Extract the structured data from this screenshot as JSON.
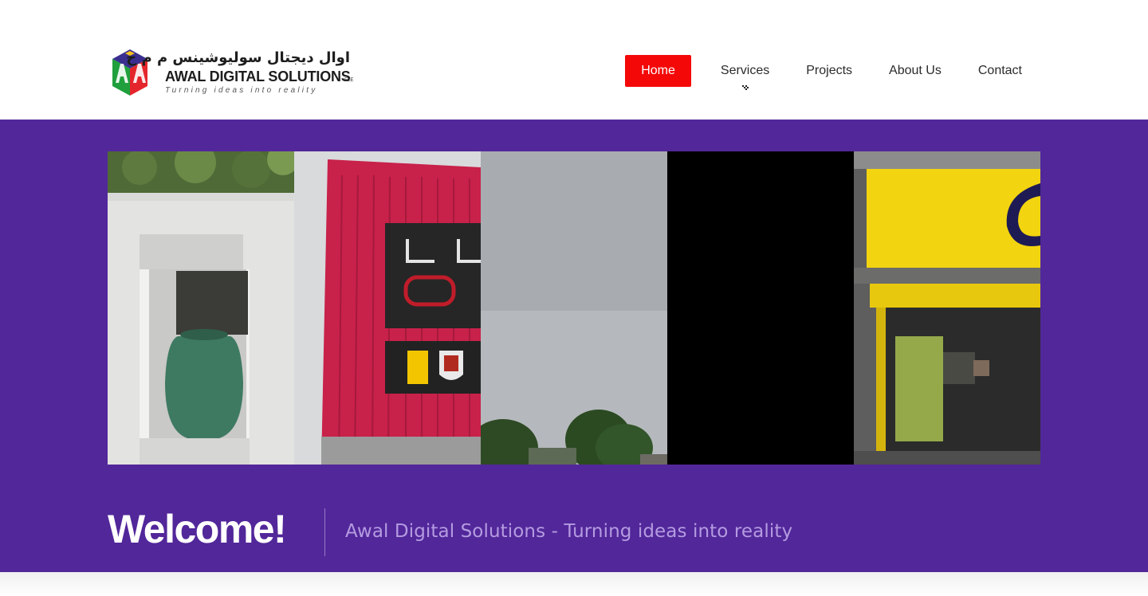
{
  "header": {
    "logo": {
      "arabic_name": "اوال ديجتال سوليوشينس م م ح",
      "name": "AWAL DIGITAL SOLUTIONS",
      "suffix": "FZE",
      "tagline": "Turning ideas into reality"
    },
    "nav": {
      "home": "Home",
      "services": "Services",
      "projects": "Projects",
      "about": "About Us",
      "contact": "Contact"
    }
  },
  "hero": {
    "slider_panels": [
      {
        "icon": "vase-niche-photo"
      },
      {
        "icon": "storefront-sign-photo"
      },
      {
        "icon": "sky-trees-photo"
      },
      {
        "icon": "black-photo"
      },
      {
        "icon": "yellow-shopfront-photo"
      }
    ],
    "welcome": "Welcome!",
    "tagline": "Awal Digital Solutions - Turning ideas into reality"
  },
  "colors": {
    "hero_bg": "#52279a",
    "nav_active": "#f40808",
    "tagline": "#b49be0"
  }
}
